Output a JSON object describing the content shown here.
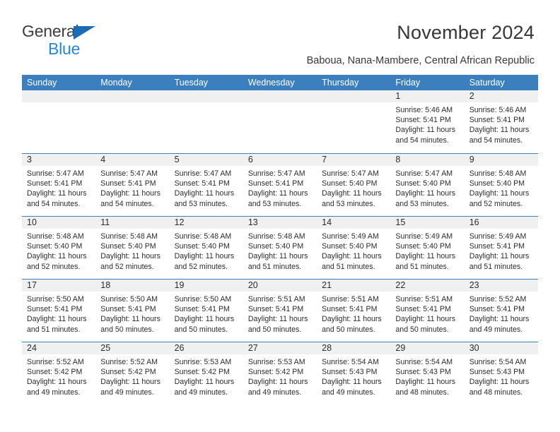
{
  "brand": {
    "name_part1": "General",
    "name_part2": "Blue",
    "triangle_color": "#1b6cb5",
    "blue_text_color": "#2b86d4"
  },
  "header": {
    "title": "November 2024",
    "subtitle": "Baboua, Nana-Mambere, Central African Republic"
  },
  "theme": {
    "header_band_color": "#3b7fbf",
    "day_number_band_color": "#f0f0f0",
    "text_color": "#2b2b2b"
  },
  "calendar": {
    "weekdays": [
      "Sunday",
      "Monday",
      "Tuesday",
      "Wednesday",
      "Thursday",
      "Friday",
      "Saturday"
    ],
    "weeks": [
      [
        {
          "day": "",
          "empty": true
        },
        {
          "day": "",
          "empty": true
        },
        {
          "day": "",
          "empty": true
        },
        {
          "day": "",
          "empty": true
        },
        {
          "day": "",
          "empty": true
        },
        {
          "day": "1",
          "sunrise": "Sunrise: 5:46 AM",
          "sunset": "Sunset: 5:41 PM",
          "daylight1": "Daylight: 11 hours",
          "daylight2": "and 54 minutes."
        },
        {
          "day": "2",
          "sunrise": "Sunrise: 5:46 AM",
          "sunset": "Sunset: 5:41 PM",
          "daylight1": "Daylight: 11 hours",
          "daylight2": "and 54 minutes."
        }
      ],
      [
        {
          "day": "3",
          "sunrise": "Sunrise: 5:47 AM",
          "sunset": "Sunset: 5:41 PM",
          "daylight1": "Daylight: 11 hours",
          "daylight2": "and 54 minutes."
        },
        {
          "day": "4",
          "sunrise": "Sunrise: 5:47 AM",
          "sunset": "Sunset: 5:41 PM",
          "daylight1": "Daylight: 11 hours",
          "daylight2": "and 54 minutes."
        },
        {
          "day": "5",
          "sunrise": "Sunrise: 5:47 AM",
          "sunset": "Sunset: 5:41 PM",
          "daylight1": "Daylight: 11 hours",
          "daylight2": "and 53 minutes."
        },
        {
          "day": "6",
          "sunrise": "Sunrise: 5:47 AM",
          "sunset": "Sunset: 5:41 PM",
          "daylight1": "Daylight: 11 hours",
          "daylight2": "and 53 minutes."
        },
        {
          "day": "7",
          "sunrise": "Sunrise: 5:47 AM",
          "sunset": "Sunset: 5:40 PM",
          "daylight1": "Daylight: 11 hours",
          "daylight2": "and 53 minutes."
        },
        {
          "day": "8",
          "sunrise": "Sunrise: 5:47 AM",
          "sunset": "Sunset: 5:40 PM",
          "daylight1": "Daylight: 11 hours",
          "daylight2": "and 53 minutes."
        },
        {
          "day": "9",
          "sunrise": "Sunrise: 5:48 AM",
          "sunset": "Sunset: 5:40 PM",
          "daylight1": "Daylight: 11 hours",
          "daylight2": "and 52 minutes."
        }
      ],
      [
        {
          "day": "10",
          "sunrise": "Sunrise: 5:48 AM",
          "sunset": "Sunset: 5:40 PM",
          "daylight1": "Daylight: 11 hours",
          "daylight2": "and 52 minutes."
        },
        {
          "day": "11",
          "sunrise": "Sunrise: 5:48 AM",
          "sunset": "Sunset: 5:40 PM",
          "daylight1": "Daylight: 11 hours",
          "daylight2": "and 52 minutes."
        },
        {
          "day": "12",
          "sunrise": "Sunrise: 5:48 AM",
          "sunset": "Sunset: 5:40 PM",
          "daylight1": "Daylight: 11 hours",
          "daylight2": "and 52 minutes."
        },
        {
          "day": "13",
          "sunrise": "Sunrise: 5:48 AM",
          "sunset": "Sunset: 5:40 PM",
          "daylight1": "Daylight: 11 hours",
          "daylight2": "and 51 minutes."
        },
        {
          "day": "14",
          "sunrise": "Sunrise: 5:49 AM",
          "sunset": "Sunset: 5:40 PM",
          "daylight1": "Daylight: 11 hours",
          "daylight2": "and 51 minutes."
        },
        {
          "day": "15",
          "sunrise": "Sunrise: 5:49 AM",
          "sunset": "Sunset: 5:40 PM",
          "daylight1": "Daylight: 11 hours",
          "daylight2": "and 51 minutes."
        },
        {
          "day": "16",
          "sunrise": "Sunrise: 5:49 AM",
          "sunset": "Sunset: 5:41 PM",
          "daylight1": "Daylight: 11 hours",
          "daylight2": "and 51 minutes."
        }
      ],
      [
        {
          "day": "17",
          "sunrise": "Sunrise: 5:50 AM",
          "sunset": "Sunset: 5:41 PM",
          "daylight1": "Daylight: 11 hours",
          "daylight2": "and 51 minutes."
        },
        {
          "day": "18",
          "sunrise": "Sunrise: 5:50 AM",
          "sunset": "Sunset: 5:41 PM",
          "daylight1": "Daylight: 11 hours",
          "daylight2": "and 50 minutes."
        },
        {
          "day": "19",
          "sunrise": "Sunrise: 5:50 AM",
          "sunset": "Sunset: 5:41 PM",
          "daylight1": "Daylight: 11 hours",
          "daylight2": "and 50 minutes."
        },
        {
          "day": "20",
          "sunrise": "Sunrise: 5:51 AM",
          "sunset": "Sunset: 5:41 PM",
          "daylight1": "Daylight: 11 hours",
          "daylight2": "and 50 minutes."
        },
        {
          "day": "21",
          "sunrise": "Sunrise: 5:51 AM",
          "sunset": "Sunset: 5:41 PM",
          "daylight1": "Daylight: 11 hours",
          "daylight2": "and 50 minutes."
        },
        {
          "day": "22",
          "sunrise": "Sunrise: 5:51 AM",
          "sunset": "Sunset: 5:41 PM",
          "daylight1": "Daylight: 11 hours",
          "daylight2": "and 50 minutes."
        },
        {
          "day": "23",
          "sunrise": "Sunrise: 5:52 AM",
          "sunset": "Sunset: 5:41 PM",
          "daylight1": "Daylight: 11 hours",
          "daylight2": "and 49 minutes."
        }
      ],
      [
        {
          "day": "24",
          "sunrise": "Sunrise: 5:52 AM",
          "sunset": "Sunset: 5:42 PM",
          "daylight1": "Daylight: 11 hours",
          "daylight2": "and 49 minutes."
        },
        {
          "day": "25",
          "sunrise": "Sunrise: 5:52 AM",
          "sunset": "Sunset: 5:42 PM",
          "daylight1": "Daylight: 11 hours",
          "daylight2": "and 49 minutes."
        },
        {
          "day": "26",
          "sunrise": "Sunrise: 5:53 AM",
          "sunset": "Sunset: 5:42 PM",
          "daylight1": "Daylight: 11 hours",
          "daylight2": "and 49 minutes."
        },
        {
          "day": "27",
          "sunrise": "Sunrise: 5:53 AM",
          "sunset": "Sunset: 5:42 PM",
          "daylight1": "Daylight: 11 hours",
          "daylight2": "and 49 minutes."
        },
        {
          "day": "28",
          "sunrise": "Sunrise: 5:54 AM",
          "sunset": "Sunset: 5:43 PM",
          "daylight1": "Daylight: 11 hours",
          "daylight2": "and 49 minutes."
        },
        {
          "day": "29",
          "sunrise": "Sunrise: 5:54 AM",
          "sunset": "Sunset: 5:43 PM",
          "daylight1": "Daylight: 11 hours",
          "daylight2": "and 48 minutes."
        },
        {
          "day": "30",
          "sunrise": "Sunrise: 5:54 AM",
          "sunset": "Sunset: 5:43 PM",
          "daylight1": "Daylight: 11 hours",
          "daylight2": "and 48 minutes."
        }
      ]
    ]
  }
}
